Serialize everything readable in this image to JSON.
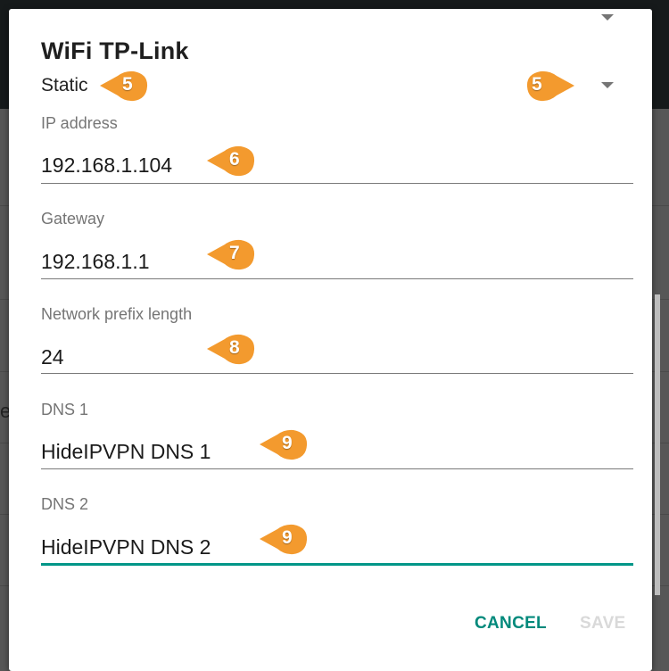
{
  "dialog": {
    "title": "WiFi TP-Link",
    "ip_settings_mode": "Static",
    "fields": [
      {
        "label": "IP address",
        "value": "192.168.1.104"
      },
      {
        "label": "Gateway",
        "value": "192.168.1.1"
      },
      {
        "label": "Network prefix length",
        "value": "24"
      },
      {
        "label": "DNS 1",
        "value": "HideIPVPN DNS 1"
      },
      {
        "label": "DNS 2",
        "value": "HideIPVPN DNS 2"
      }
    ],
    "buttons": {
      "cancel": "CANCEL",
      "save": "SAVE"
    }
  },
  "background": {
    "partial_text": "e"
  },
  "annotations": [
    {
      "number": "5",
      "target": "ip-settings-mode"
    },
    {
      "number": "5",
      "target": "ip-settings-dropdown"
    },
    {
      "number": "6",
      "target": "ip-address"
    },
    {
      "number": "7",
      "target": "gateway"
    },
    {
      "number": "8",
      "target": "network-prefix-length"
    },
    {
      "number": "9",
      "target": "dns-1"
    },
    {
      "number": "9",
      "target": "dns-2"
    }
  ],
  "colors": {
    "accent": "#009688",
    "annotation": "#f39a2e",
    "disabled": "#d9d9d9"
  }
}
